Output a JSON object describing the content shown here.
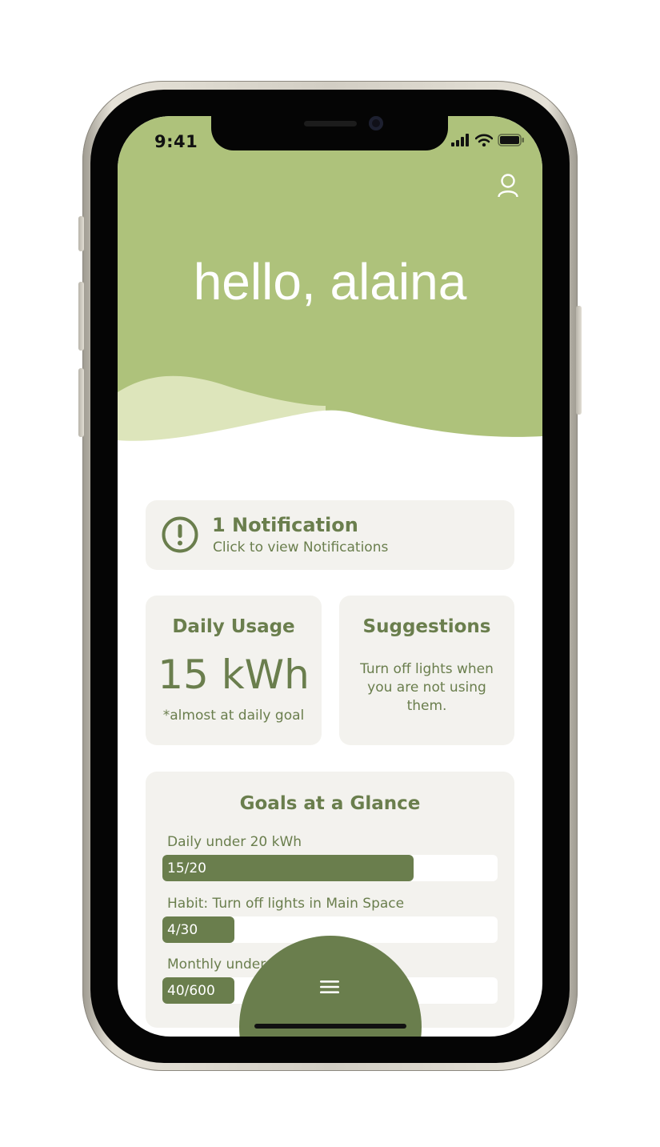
{
  "status_bar": {
    "time": "9:41"
  },
  "header": {
    "greeting": "hello, alaina"
  },
  "notification": {
    "title": "1 Notification",
    "subtitle": "Click to view Notifications"
  },
  "daily_usage": {
    "heading": "Daily Usage",
    "value": "15 kWh",
    "note": "*almost at daily goal"
  },
  "suggestions": {
    "heading": "Suggestions",
    "text": "Turn off lights when you are not using them."
  },
  "goals": {
    "heading": "Goals at a Glance",
    "items": [
      {
        "label": "Daily under 20 kWh",
        "value_text": "15/20",
        "current": 15,
        "target": 20
      },
      {
        "label": "Habit: Turn off lights in Main Space",
        "value_text": "4/30",
        "current": 4,
        "target": 30
      },
      {
        "label": "Monthly under",
        "value_text": "40/600",
        "current": 40,
        "target": 600
      }
    ]
  },
  "colors": {
    "header_green": "#aec27b",
    "wave_light_green": "#dde5bb",
    "accent_dark_green": "#6a7e4d",
    "card_bg": "#f3f2ee"
  },
  "icons": [
    "profile-icon",
    "alert-icon",
    "menu-icon",
    "signal-icon",
    "wifi-icon",
    "battery-icon"
  ]
}
